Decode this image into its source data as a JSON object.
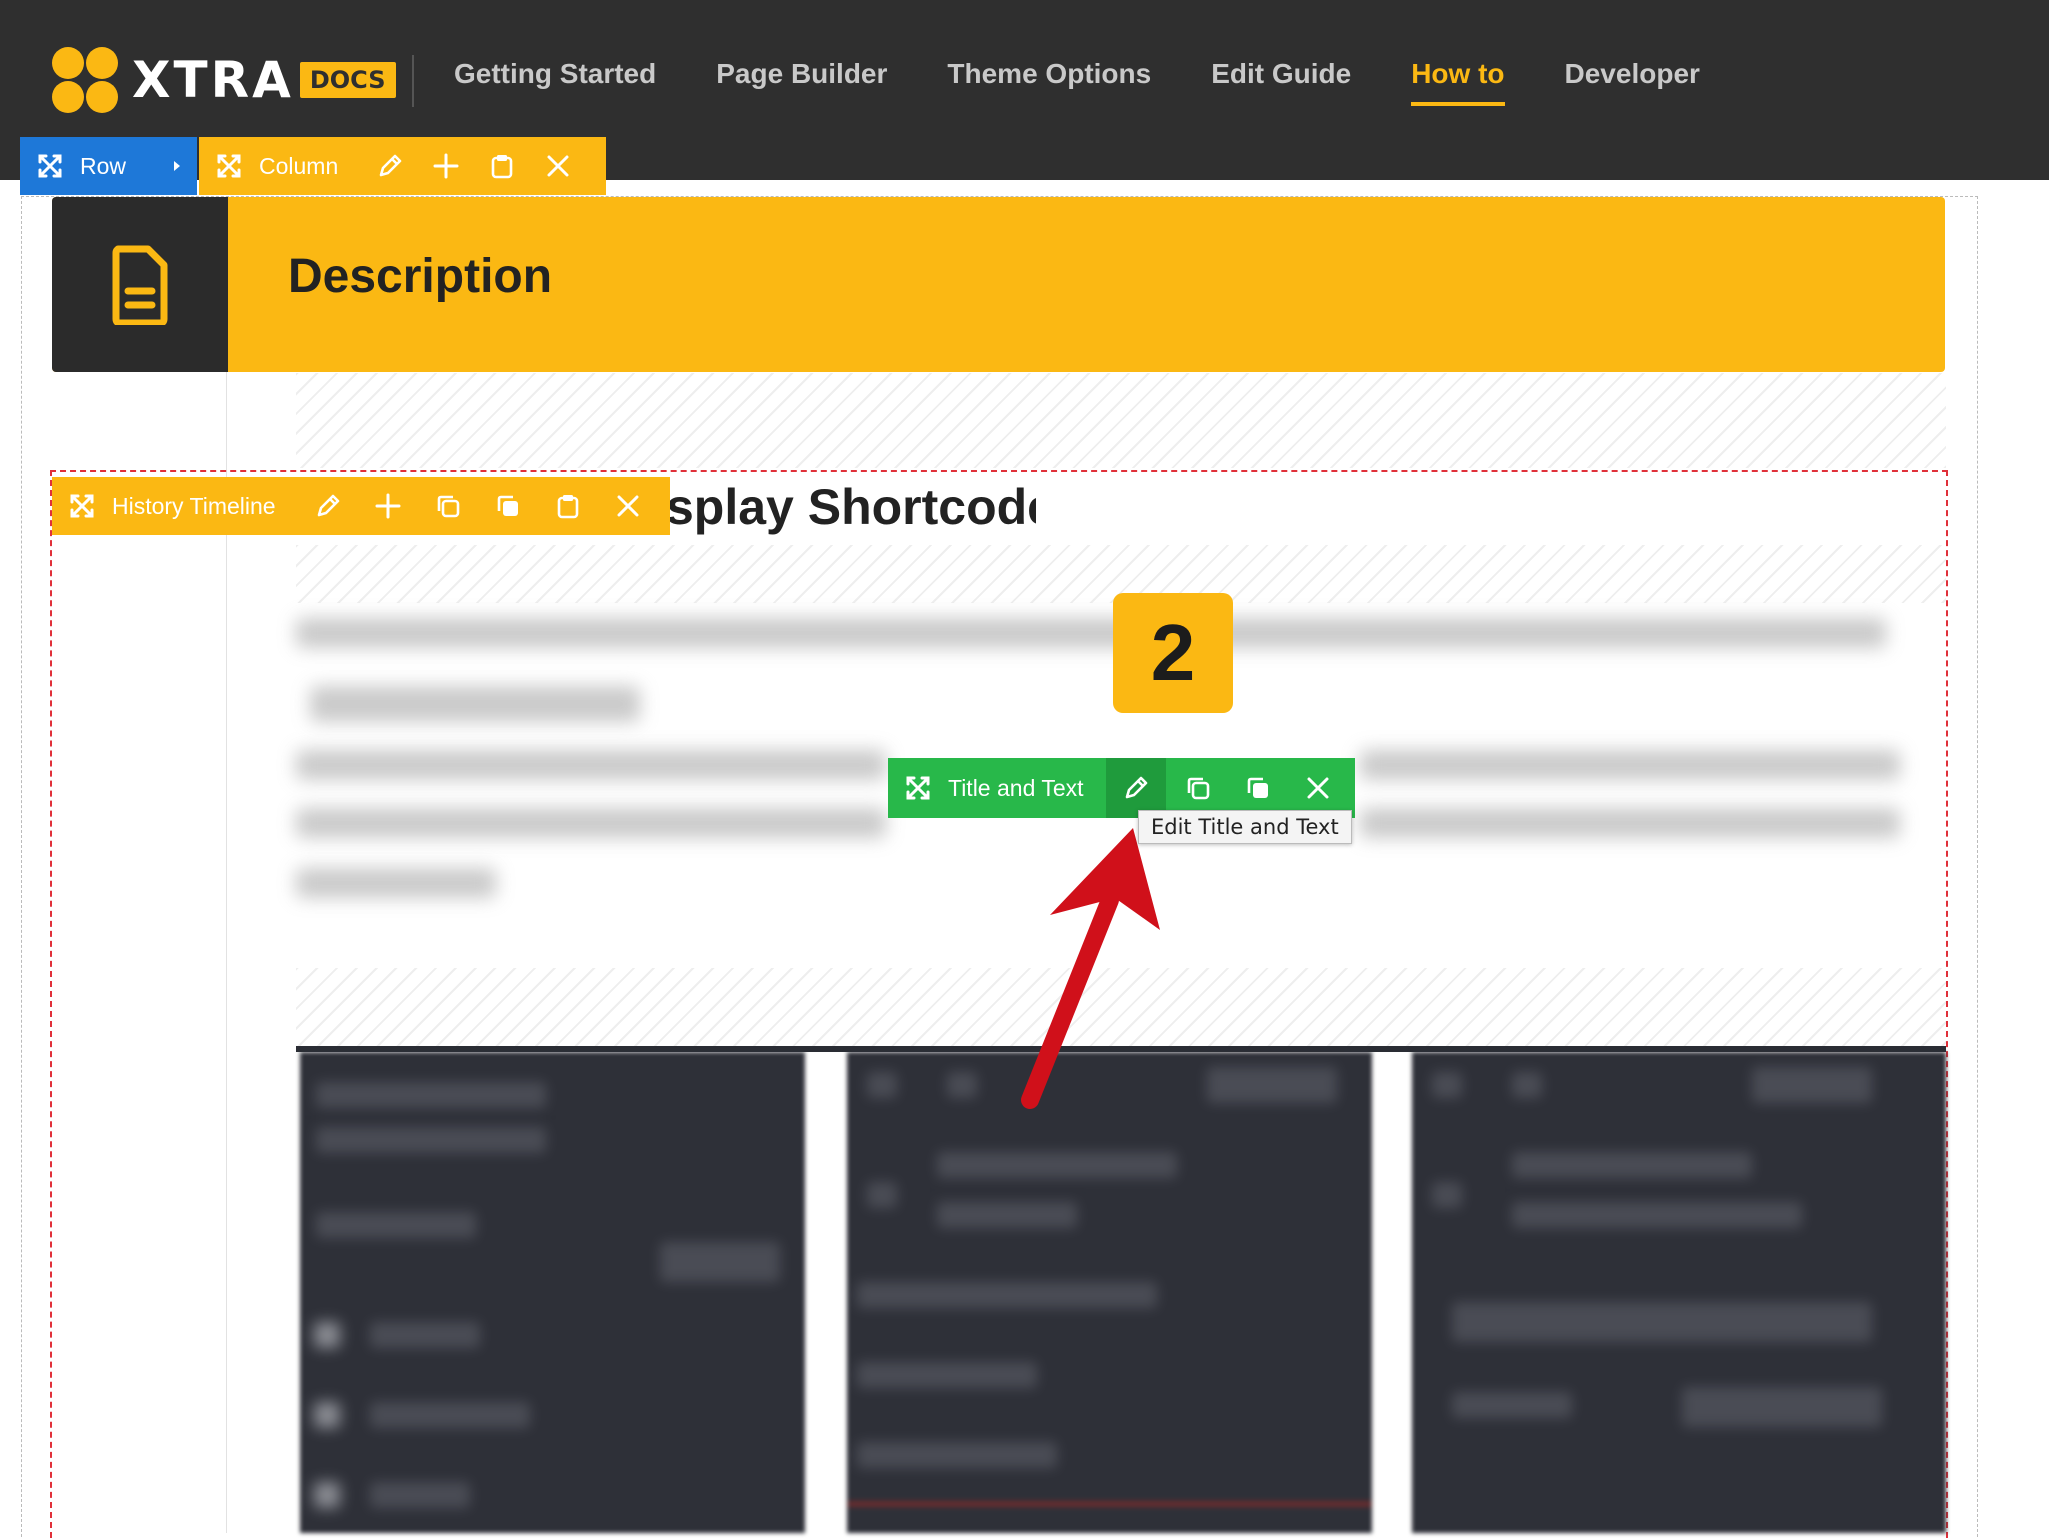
{
  "header": {
    "logo_text": "XTRA",
    "logo_badge": "DOCS",
    "nav": [
      {
        "label": "Getting Started",
        "active": false
      },
      {
        "label": "Page Builder",
        "active": false
      },
      {
        "label": "Theme Options",
        "active": false
      },
      {
        "label": "Edit Guide",
        "active": false
      },
      {
        "label": "How to",
        "active": true
      },
      {
        "label": "Developer",
        "active": false
      }
    ]
  },
  "toolbars": {
    "row": {
      "label": "Row"
    },
    "column": {
      "label": "Column"
    },
    "history": {
      "label": "History Timeline"
    },
    "title_text": {
      "label": "Title and Text",
      "tooltip": "Edit Title and Text"
    }
  },
  "content": {
    "description_title": "Description",
    "section_heading": "splay Shortcode",
    "step_badge": "2"
  },
  "colors": {
    "header_bg": "#2f2f2f",
    "accent_yellow": "#fbb813",
    "row_blue": "#1e78d8",
    "element_green": "#28b84a",
    "dashed_red": "#e0303a",
    "arrow_red": "#d0101a"
  },
  "icons": {
    "move": "move-arrows-icon",
    "edit": "pencil-icon",
    "add": "plus-icon",
    "copy": "copy-icon",
    "clone": "clone-icon",
    "paste": "clipboard-icon",
    "delete": "close-icon",
    "document": "document-icon",
    "expand": "caret-right-icon"
  }
}
